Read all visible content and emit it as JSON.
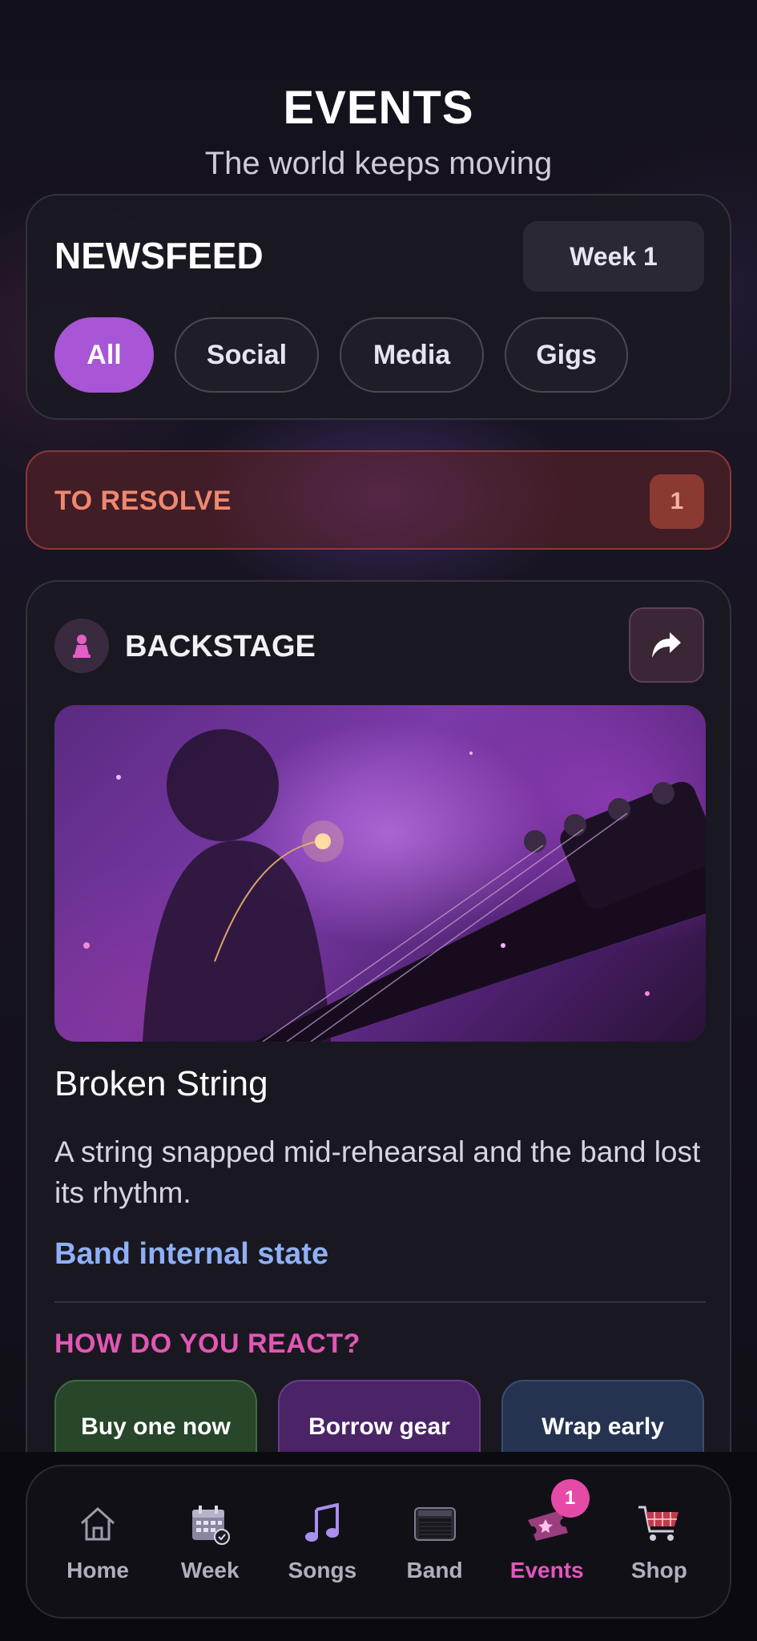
{
  "header": {
    "title": "EVENTS",
    "subtitle": "The world keeps moving"
  },
  "newsfeed": {
    "title": "NEWSFEED",
    "week_label": "Week 1",
    "filters": [
      {
        "label": "All",
        "active": true
      },
      {
        "label": "Social",
        "active": false
      },
      {
        "label": "Media",
        "active": false
      },
      {
        "label": "Gigs",
        "active": false
      }
    ]
  },
  "to_resolve": {
    "label": "TO RESOLVE",
    "count": "1"
  },
  "event": {
    "source": "BACKSTAGE",
    "source_icon": "pawn-icon",
    "share_icon": "share-arrow-icon",
    "image_subject": "guitar-broken-string",
    "title": "Broken String",
    "description": "A string snapped mid-rehearsal and the band lost its rhythm.",
    "tag": "Band internal state",
    "react_label": "HOW DO YOU REACT?",
    "options": [
      {
        "label": "Buy one now",
        "color": "#27462a"
      },
      {
        "label": "Borrow gear",
        "color": "#4a2466"
      },
      {
        "label": "Wrap early",
        "color": "#253350"
      }
    ]
  },
  "nav": {
    "items": [
      {
        "label": "Home",
        "icon": "home-icon"
      },
      {
        "label": "Week",
        "icon": "calendar-icon"
      },
      {
        "label": "Songs",
        "icon": "music-note-icon"
      },
      {
        "label": "Band",
        "icon": "amplifier-icon"
      },
      {
        "label": "Events",
        "icon": "ticket-icon",
        "active": true,
        "badge": "1"
      },
      {
        "label": "Shop",
        "icon": "cart-icon"
      }
    ]
  },
  "colors": {
    "accent": "#a855d6",
    "active_nav": "#e655c0",
    "resolve": "#f0876f",
    "tag": "#8fb0f6",
    "react": "#e356b5"
  }
}
